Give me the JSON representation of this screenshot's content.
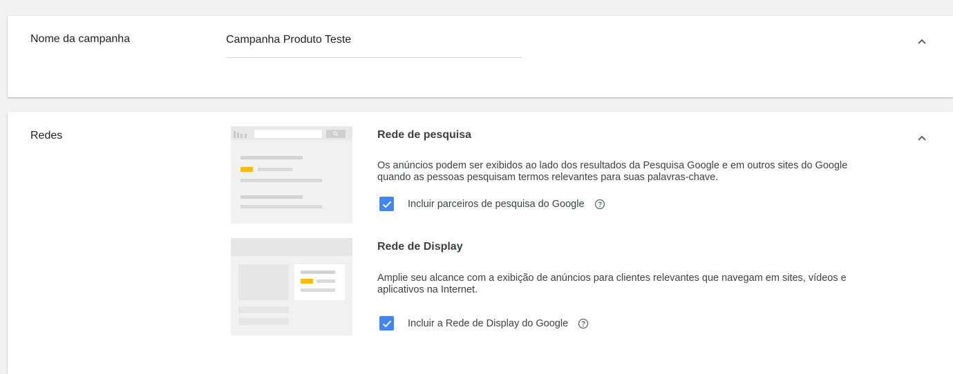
{
  "campaign_name": {
    "label": "Nome da campanha",
    "value": "Campanha Produto Teste"
  },
  "networks": {
    "label": "Redes",
    "search": {
      "title": "Rede de pesquisa",
      "description": "Os anúncios podem ser exibidos ao lado dos resultados da Pesquisa Google e em outros sites do Google quando as pessoas pesquisam termos relevantes para suas palavras-chave.",
      "checkbox_label": "Incluir parceiros de pesquisa do Google",
      "checked": true
    },
    "display": {
      "title": "Rede de Display",
      "description": "Amplie seu alcance com a exibição de anúncios para clientes relevantes que navegam em sites, vídeos e aplicativos na Internet.",
      "checkbox_label": "Incluir a Rede de Display do Google",
      "checked": true
    }
  },
  "icons": {
    "collapse": "chevron-up-icon",
    "help": "help-circle-icon",
    "check": "check-icon"
  },
  "colors": {
    "checkbox": "#4285f4",
    "accent_yellow": "#fbbc05"
  }
}
